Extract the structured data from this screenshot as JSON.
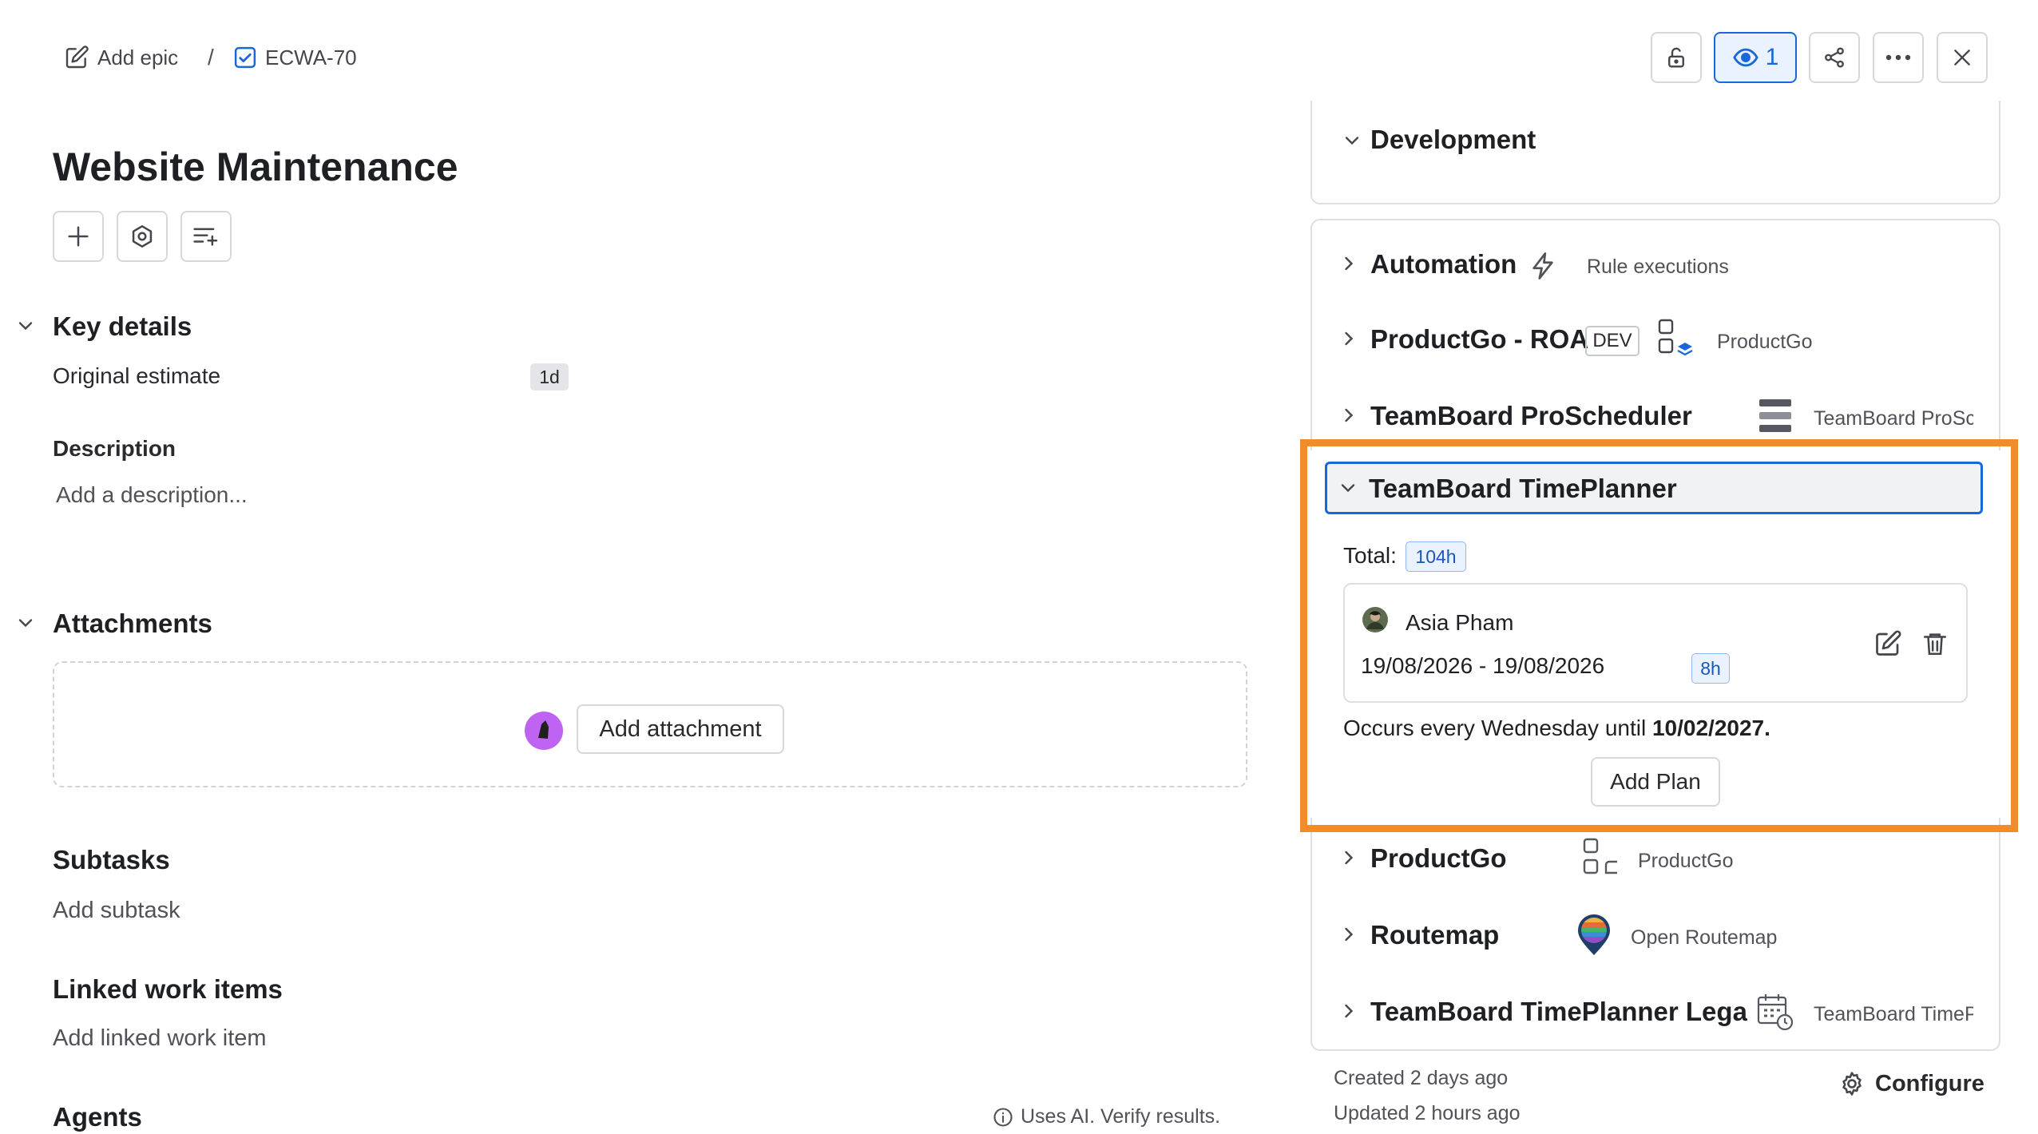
{
  "breadcrumb": {
    "add_epic": "Add epic",
    "separator": "/",
    "issue_key": "ECWA-70"
  },
  "header_actions": {
    "watch_count": "1"
  },
  "issue": {
    "title": "Website Maintenance"
  },
  "key_details": {
    "heading": "Key details",
    "original_estimate_label": "Original estimate",
    "original_estimate_value": "1d"
  },
  "description": {
    "heading": "Description",
    "placeholder": "Add a description..."
  },
  "attachments": {
    "heading": "Attachments",
    "add_button": "Add attachment"
  },
  "subtasks": {
    "heading": "Subtasks",
    "add_link": "Add subtask"
  },
  "linked_items": {
    "heading": "Linked work items",
    "add_link": "Add linked work item"
  },
  "agents": {
    "heading": "Agents",
    "ai_note": "Uses AI. Verify results."
  },
  "sidebar": {
    "development": {
      "title": "Development"
    },
    "apps": [
      {
        "title": "Automation",
        "sub": "Rule executions",
        "icon": "lightning-icon"
      },
      {
        "title": "ProductGo - ROA",
        "badge": "DEV",
        "sub": "ProductGo",
        "icon": "productgo-logo-icon"
      },
      {
        "title": "TeamBoard ProScheduler",
        "sub": "TeamBoard ProSch",
        "icon": "proscheduler-logo-icon"
      }
    ],
    "timeplanner": {
      "title": "TeamBoard TimePlanner",
      "total_label": "Total:",
      "total_value": "104h",
      "plan": {
        "user": "Asia Pham",
        "date_range": "19/08/2026 - 19/08/2026",
        "hours": "8h"
      },
      "recurrence_prefix": "Occurs every Wednesday until ",
      "recurrence_date": "10/02/2027.",
      "add_plan_button": "Add Plan"
    },
    "apps_after": [
      {
        "title": "ProductGo",
        "sub": "ProductGo",
        "icon": "productgo-logo-icon"
      },
      {
        "title": "Routemap",
        "sub": "Open Routemap",
        "icon": "routemap-logo-icon"
      },
      {
        "title": "TeamBoard TimePlanner Legac",
        "sub": "TeamBoard TimeP",
        "icon": "calendar-clock-icon"
      }
    ],
    "footer": {
      "created": "Created 2 days ago",
      "updated": "Updated 2 hours ago",
      "configure": "Configure"
    }
  },
  "colors": {
    "highlight": "#f28c28",
    "selected_border": "#1868db",
    "badge_blue_bg": "#e9f2fe",
    "text_primary": "#292a2e"
  }
}
